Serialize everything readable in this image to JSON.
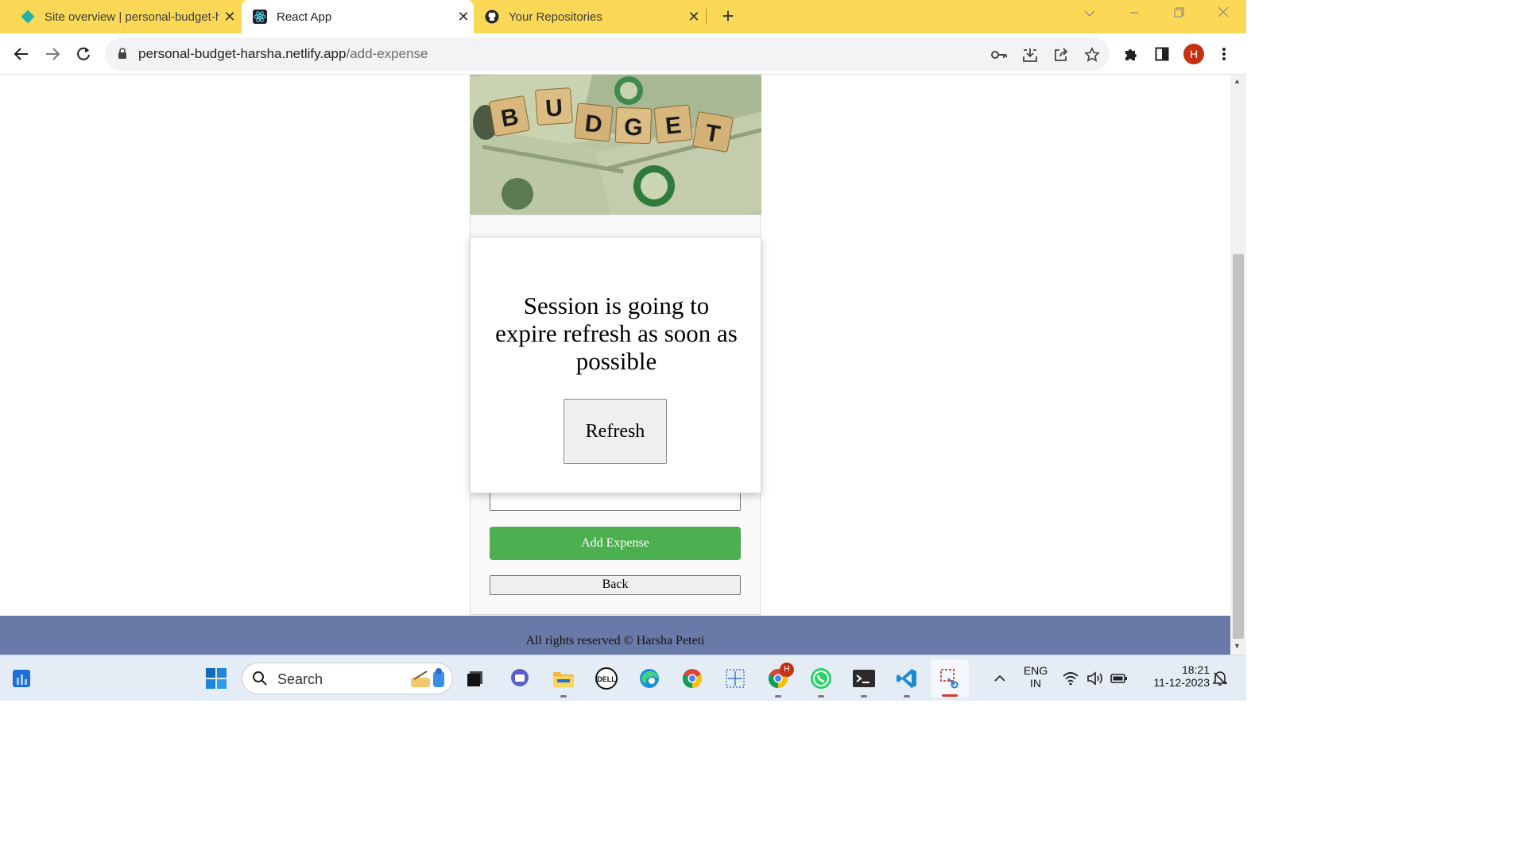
{
  "browser": {
    "tabs": [
      {
        "title": "Site overview | personal-budget-harsha",
        "icon": "netlify-icon",
        "active": false
      },
      {
        "title": "React App",
        "icon": "react-icon",
        "active": true
      },
      {
        "title": "Your Repositories",
        "icon": "github-icon",
        "active": false
      }
    ],
    "new_tab_label": "+",
    "url_host": "personal-budget-harsha.netlify.app",
    "url_path": "/add-expense",
    "profile_initial": "H"
  },
  "page": {
    "hero_letters": [
      "B",
      "U",
      "D",
      "G",
      "E",
      "T"
    ],
    "buttons": {
      "add_expense": "Add Expense",
      "back": "Back"
    },
    "modal": {
      "message": "Session is going to expire refresh as soon as possible",
      "refresh_label": "Refresh"
    },
    "footer_text": "All rights reserved © Harsha Peteti"
  },
  "taskbar": {
    "search_label": "Search",
    "apps": [
      "start-icon",
      "search",
      "task-view-icon",
      "teams-icon",
      "file-explorer-icon",
      "dell-icon",
      "edge-icon",
      "chrome-icon",
      "snipping-grid-icon",
      "chrome-profile-icon",
      "whatsapp-icon",
      "terminal-icon",
      "vscode-icon",
      "snipping-tool-icon"
    ],
    "chrome_profile_badge": "H",
    "dell_label": "DELL",
    "lang_top": "ENG",
    "lang_bottom": "IN",
    "time": "18:21",
    "date": "11-12-2023"
  },
  "colors": {
    "tabbar": "#fbd957",
    "add_button": "#4caf50",
    "footer": "#6a7aa8",
    "taskbar": "#e4ecf6"
  }
}
